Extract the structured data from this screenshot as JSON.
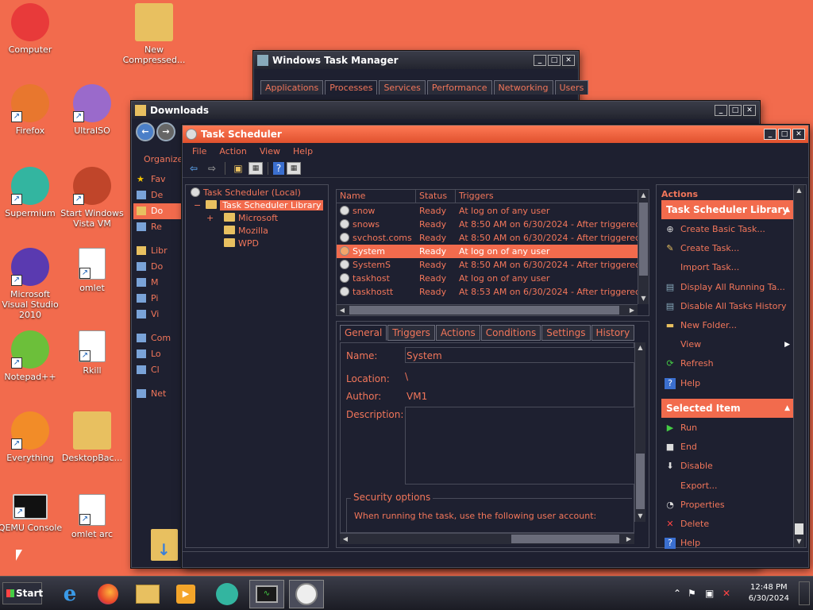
{
  "desktop": {
    "icons": [
      {
        "label": "Computer",
        "color": "#e83a3a"
      },
      {
        "label": "New Compressed...",
        "color": "#e8c060"
      },
      {
        "label": "Firefox",
        "color": "#e8772e"
      },
      {
        "label": "UltraISO",
        "color": "#9a6acb"
      },
      {
        "label": "Supermium",
        "color": "#33b5a0"
      },
      {
        "label": "Start Windows Vista VM",
        "color": "#c0452a"
      },
      {
        "label": "Microsoft Visual Studio 2010",
        "color": "#5a3ab0"
      },
      {
        "label": "omlet",
        "color": "#ffffff"
      },
      {
        "label": "Notepad++",
        "color": "#6cbf3a"
      },
      {
        "label": "Rkill",
        "color": "#ffffff"
      },
      {
        "label": "Everything",
        "color": "#f28c28"
      },
      {
        "label": "DesktopBac...",
        "color": "#e8c060"
      },
      {
        "label": "QEMU Console",
        "color": "#111111"
      },
      {
        "label": "omlet arc",
        "color": "#ffffff"
      }
    ]
  },
  "task_manager": {
    "title": "Windows Task Manager",
    "tabs": [
      "Applications",
      "Processes",
      "Services",
      "Performance",
      "Networking",
      "Users"
    ],
    "selected_tab": "Processes"
  },
  "downloads": {
    "title": "Downloads",
    "organize": "Organize",
    "side": [
      "Fav",
      "De",
      "Do",
      "Re",
      "Libr",
      "Do",
      "M",
      "Pi",
      "Vi",
      "Com",
      "Lo",
      "Cl",
      "Net"
    ]
  },
  "scheduler": {
    "title": "Task Scheduler",
    "menu": [
      "File",
      "Action",
      "View",
      "Help"
    ],
    "tree": {
      "root": "Task Scheduler (Local)",
      "library": "Task Scheduler Library",
      "children": [
        "Microsoft",
        "Mozilla",
        "WPD"
      ]
    },
    "task_list": {
      "columns": [
        "Name",
        "Status",
        "Triggers"
      ],
      "rows": [
        {
          "name": "snow",
          "status": "Ready",
          "trigger": "At log on of any user"
        },
        {
          "name": "snows",
          "status": "Ready",
          "trigger": "At 8:50 AM on 6/30/2024 - After triggered, re"
        },
        {
          "name": "svchost.coms",
          "status": "Ready",
          "trigger": "At 8:50 AM on 6/30/2024 - After triggered, re"
        },
        {
          "name": "System",
          "status": "Ready",
          "trigger": "At log on of any user"
        },
        {
          "name": "SystemS",
          "status": "Ready",
          "trigger": "At 8:50 AM on 6/30/2024 - After triggered, re"
        },
        {
          "name": "taskhost",
          "status": "Ready",
          "trigger": "At log on of any user"
        },
        {
          "name": "taskhostt",
          "status": "Ready",
          "trigger": "At 8:53 AM on 6/30/2024 - After triggered, re"
        }
      ],
      "selected": "System"
    },
    "detail": {
      "tabs": [
        "General",
        "Triggers",
        "Actions",
        "Conditions",
        "Settings",
        "History"
      ],
      "selected_tab": "General",
      "name_label": "Name:",
      "name_value": "System",
      "location_label": "Location:",
      "location_value": "\\",
      "author_label": "Author:",
      "author_value": "VM1",
      "description_label": "Description:",
      "security_label": "Security options",
      "security_text": "When running the task, use the following user account:"
    },
    "actions": {
      "header": "Actions",
      "section1": "Task Scheduler Library",
      "items1": [
        {
          "label": "Create Basic Task...",
          "icon": "create-basic-task-icon"
        },
        {
          "label": "Create Task...",
          "icon": "create-task-icon"
        },
        {
          "label": "Import Task...",
          "icon": ""
        },
        {
          "label": "Display All Running Ta...",
          "icon": "running-tasks-icon"
        },
        {
          "label": "Disable All Tasks History",
          "icon": "history-icon"
        },
        {
          "label": "New Folder...",
          "icon": "folder-icon"
        },
        {
          "label": "View",
          "icon": ""
        },
        {
          "label": "Refresh",
          "icon": "refresh-icon"
        },
        {
          "label": "Help",
          "icon": "help-icon"
        }
      ],
      "section2": "Selected Item",
      "items2": [
        {
          "label": "Run",
          "icon": "run-icon"
        },
        {
          "label": "End",
          "icon": "end-icon"
        },
        {
          "label": "Disable",
          "icon": "disable-icon"
        },
        {
          "label": "Export...",
          "icon": ""
        },
        {
          "label": "Properties",
          "icon": "properties-icon"
        },
        {
          "label": "Delete",
          "icon": "delete-icon"
        },
        {
          "label": "Help",
          "icon": "help-icon"
        }
      ]
    }
  },
  "taskbar": {
    "start": "Start",
    "time": "12:48 PM",
    "date": "6/30/2024"
  }
}
